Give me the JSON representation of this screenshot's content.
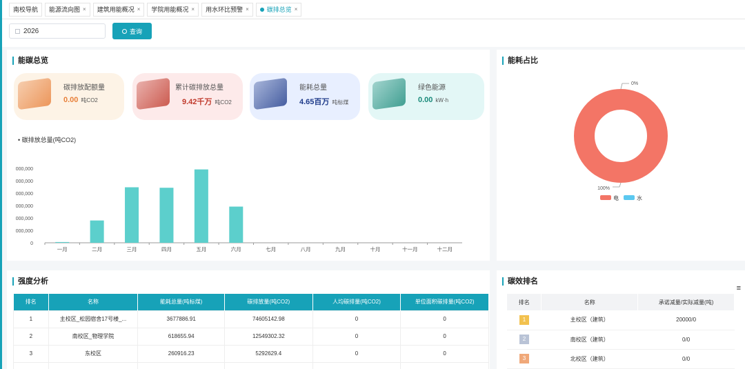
{
  "tabs": [
    {
      "label": "南校导航",
      "closable": false,
      "active": false
    },
    {
      "label": "能源流向图",
      "closable": true,
      "active": false
    },
    {
      "label": "建筑用能概况",
      "closable": true,
      "active": false
    },
    {
      "label": "学院用能概况",
      "closable": true,
      "active": false
    },
    {
      "label": "用水环比预警",
      "closable": true,
      "active": false
    },
    {
      "label": "碳排总览",
      "closable": true,
      "active": true
    }
  ],
  "filter": {
    "year": "2026",
    "query_label": "查询"
  },
  "overview": {
    "title": "能碳总览",
    "kpis": [
      {
        "label": "碳排放配额量",
        "value": "0.00",
        "unit": "吨CO2",
        "color": "#e8803a",
        "bg": "#fdf3e6",
        "icon": "quota-icon"
      },
      {
        "label": "累计碳排放总量",
        "value": "9.42千万",
        "unit": "吨CO2",
        "color": "#c0392b",
        "bg": "#fdeaea",
        "icon": "emission-icon"
      },
      {
        "label": "能耗总量",
        "value": "4.65百万",
        "unit": "吨标煤",
        "color": "#1f3b8a",
        "bg": "#e8efff",
        "icon": "energy-icon"
      },
      {
        "label": "绿色能源",
        "value": "0.00",
        "unit": "kW·h",
        "color": "#1a8a7a",
        "bg": "#e3f7f6",
        "icon": "green-energy-icon"
      }
    ],
    "chart_title": "碳排放总量(吨CO2)"
  },
  "share": {
    "title": "能耗占比",
    "top_label": "0%",
    "bottom_label": "100%"
  },
  "intensity": {
    "title": "强度分析",
    "columns": [
      "排名",
      "名称",
      "能耗总量(吨标煤)",
      "碳排放量(吨CO2)",
      "人均碳排量(吨CO2)",
      "单位面积碳排量(吨CO2)"
    ],
    "rows": [
      [
        "1",
        "主校区_松园宿舍17号楼_...",
        "3677886.91",
        "74605142.98",
        "0",
        "0"
      ],
      [
        "2",
        "南校区_物理学院",
        "618655.94",
        "12549302.32",
        "0",
        "0"
      ],
      [
        "3",
        "东校区",
        "260916.23",
        "5292629.4",
        "0",
        "0"
      ]
    ]
  },
  "ranking": {
    "title": "碳效排名",
    "columns": [
      "排名",
      "名称",
      "承诺减量/实际减量(吨)"
    ],
    "rows": [
      [
        "1",
        "主校区（建筑）",
        "20000/0"
      ],
      [
        "2",
        "南校区（建筑）",
        "0/0"
      ],
      [
        "3",
        "北校区（建筑）",
        "0/0"
      ]
    ],
    "medal_colors": [
      "#f2c14e",
      "#b9c3d6",
      "#f0a879"
    ]
  },
  "chart_data": [
    {
      "type": "bar",
      "title": "碳排放总量(吨CO2)",
      "categories": [
        "一月",
        "二月",
        "三月",
        "四月",
        "五月",
        "六月",
        "七月",
        "八月",
        "九月",
        "十月",
        "十一月",
        "十二月"
      ],
      "values": [
        150000,
        4500000,
        11200000,
        11100000,
        14800000,
        7300000,
        0,
        0,
        0,
        0,
        0,
        0
      ],
      "ylim": [
        0,
        15000000
      ],
      "ytick_labels": [
        "0",
        "000,000",
        "000,000",
        "000,000",
        "000,000",
        "000,000",
        "000,000"
      ],
      "color": "#5ccfcc",
      "grid": false
    },
    {
      "type": "pie",
      "donut": true,
      "labels": [
        "电",
        "水"
      ],
      "values": [
        100,
        0
      ],
      "colors": [
        "#f37566",
        "#5bc8f0"
      ],
      "legend": "bottom"
    }
  ]
}
